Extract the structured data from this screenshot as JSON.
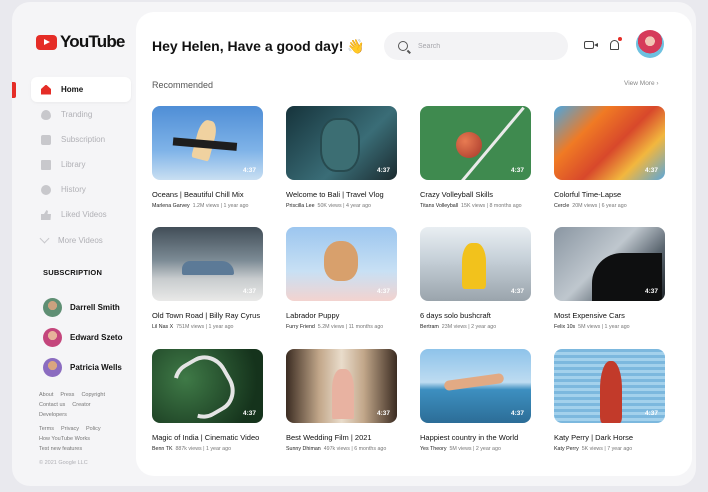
{
  "brand": {
    "name": "YouTube",
    "accent": "#e52d27"
  },
  "sidebar": {
    "nav": [
      {
        "label": "Home",
        "icon": "home-icon",
        "active": true
      },
      {
        "label": "Tranding",
        "icon": "trending-icon"
      },
      {
        "label": "Subscription",
        "icon": "subscription-icon"
      },
      {
        "label": "Library",
        "icon": "library-icon"
      },
      {
        "label": "History",
        "icon": "history-icon"
      },
      {
        "label": "Liked Videos",
        "icon": "like-icon"
      },
      {
        "label": "More Videos",
        "icon": "chevron-down-icon"
      }
    ],
    "subscription_title": "SUBSCRIPTION",
    "subscriptions": [
      {
        "name": "Darrell Smith"
      },
      {
        "name": "Edward Szeto"
      },
      {
        "name": "Patricia Wells"
      }
    ],
    "footer": {
      "row1": [
        "About",
        "Press",
        "Copyright"
      ],
      "row2": [
        "Contact us",
        "Creator"
      ],
      "row3": [
        "Developers"
      ],
      "row4": [
        "Terms",
        "Privacy",
        "Policy"
      ],
      "row5": [
        "How YouTube Works"
      ],
      "row6": [
        "Test new features"
      ],
      "copyright": "© 2021 Google LLC"
    }
  },
  "header": {
    "greeting": "Hey Helen, Have a good day! 👋",
    "search_placeholder": "Search"
  },
  "section": {
    "title": "Recommended",
    "view_more": "View More ›"
  },
  "videos": [
    {
      "title": "Oceans | Beautiful Chill Mix",
      "channel": "Marlena Garvey",
      "meta": "1.2M views | 1 year ago",
      "duration": "4:37"
    },
    {
      "title": "Welcome to Bali | Travel Vlog",
      "channel": "Priscilla Lee",
      "meta": "50K views | 4 year ago",
      "duration": "4:37"
    },
    {
      "title": "Crazy Volleyball Skills",
      "channel": "Titans Volleyball",
      "meta": "15K views | 8 months ago",
      "duration": "4:37"
    },
    {
      "title": "Colorful Time-Lapse",
      "channel": "Cercle",
      "meta": "20M views | 6 year ago",
      "duration": "4:37"
    },
    {
      "title": "Old Town Road | Billy Ray Cyrus",
      "channel": "Lil Nas X",
      "meta": "751M views | 1 year ago",
      "duration": "4:37"
    },
    {
      "title": "Labrador Puppy",
      "channel": "Furry Friend",
      "meta": "5.2M views | 11 months ago",
      "duration": "4:37"
    },
    {
      "title": "6 days solo bushcraft",
      "channel": "Bertram",
      "meta": "23M views | 2 year ago",
      "duration": "4:37"
    },
    {
      "title": "Most Expensive Cars",
      "channel": "Felix 10s",
      "meta": "5M views | 1 year ago",
      "duration": "4:37"
    },
    {
      "title": "Magic of India | Cinematic Video",
      "channel": "Benn TK",
      "meta": "887k views | 1 year ago",
      "duration": "4:37"
    },
    {
      "title": "Best Wedding Film | 2021",
      "channel": "Sunny Dhiman",
      "meta": "497k views | 6 months ago",
      "duration": "4:37"
    },
    {
      "title": "Happiest country in the World",
      "channel": "Yes Theory",
      "meta": "5M views | 2 year ago",
      "duration": "4:37"
    },
    {
      "title": "Katy Perry | Dark Horse",
      "channel": "Katy Perry",
      "meta": "5K views | 7 year ago",
      "duration": "4:37"
    }
  ]
}
